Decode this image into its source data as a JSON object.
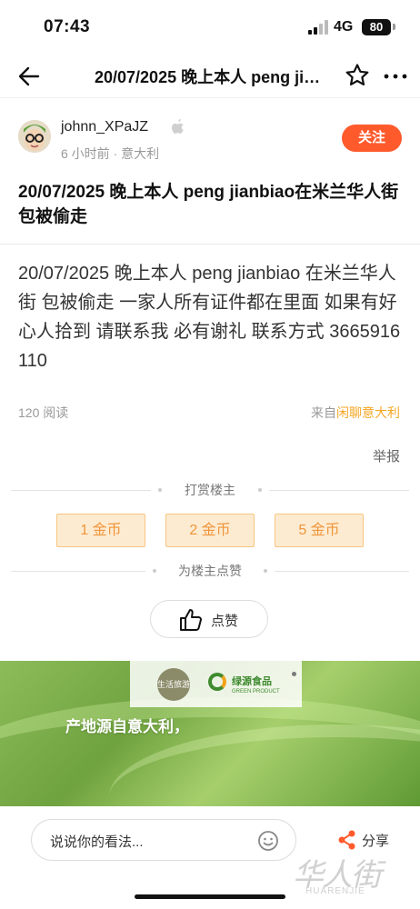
{
  "status_bar": {
    "time": "07:43",
    "network": "4G",
    "battery": "80"
  },
  "nav": {
    "title": "20/07/2025 晚上本人 peng jianbiao在米兰华人街 包被偷走",
    "back_icon": "arrow-left-icon",
    "star_icon": "star-outline-icon",
    "more_icon": "more-dots-icon"
  },
  "author": {
    "name": "johnn_XPaJZ",
    "device_icon": "apple-icon",
    "time": "6 小时前",
    "location": "意大利",
    "follow_label": "关注"
  },
  "post": {
    "title": "20/07/2025 晚上本人 peng jianbiao在米兰华人街 包被偷走",
    "body": "20/07/2025  晚上本人 peng  jianbiao 在米兰华人街 包被偷走 一家人所有证件都在里面  如果有好心人拾到  请联系我  必有谢礼 联系方式 3665916110",
    "reads": "120 阅读",
    "source_prefix": "来自",
    "source_link": "闲聊意大利",
    "report_label": "举报"
  },
  "reward": {
    "heading": "打赏楼主",
    "options": [
      "1 金币",
      "2 金币",
      "5 金币"
    ]
  },
  "like": {
    "heading": "为楼主点赞",
    "label": "点赞"
  },
  "ad": {
    "logo_text": "生活旅游",
    "brand": "绿源食品",
    "brand_sub": "GREEN PRODUCT",
    "slogan": "产地源自意大利，"
  },
  "bottom": {
    "comment_placeholder": "说说你的看法...",
    "share_label": "分享",
    "watermark_cn": "华人街",
    "watermark_en": "HUARENJIE"
  },
  "colors": {
    "accent": "#ff5a2c",
    "coin_bg": "#fdebd1",
    "coin_text": "#f0953a",
    "source_link": "#f5a623"
  }
}
